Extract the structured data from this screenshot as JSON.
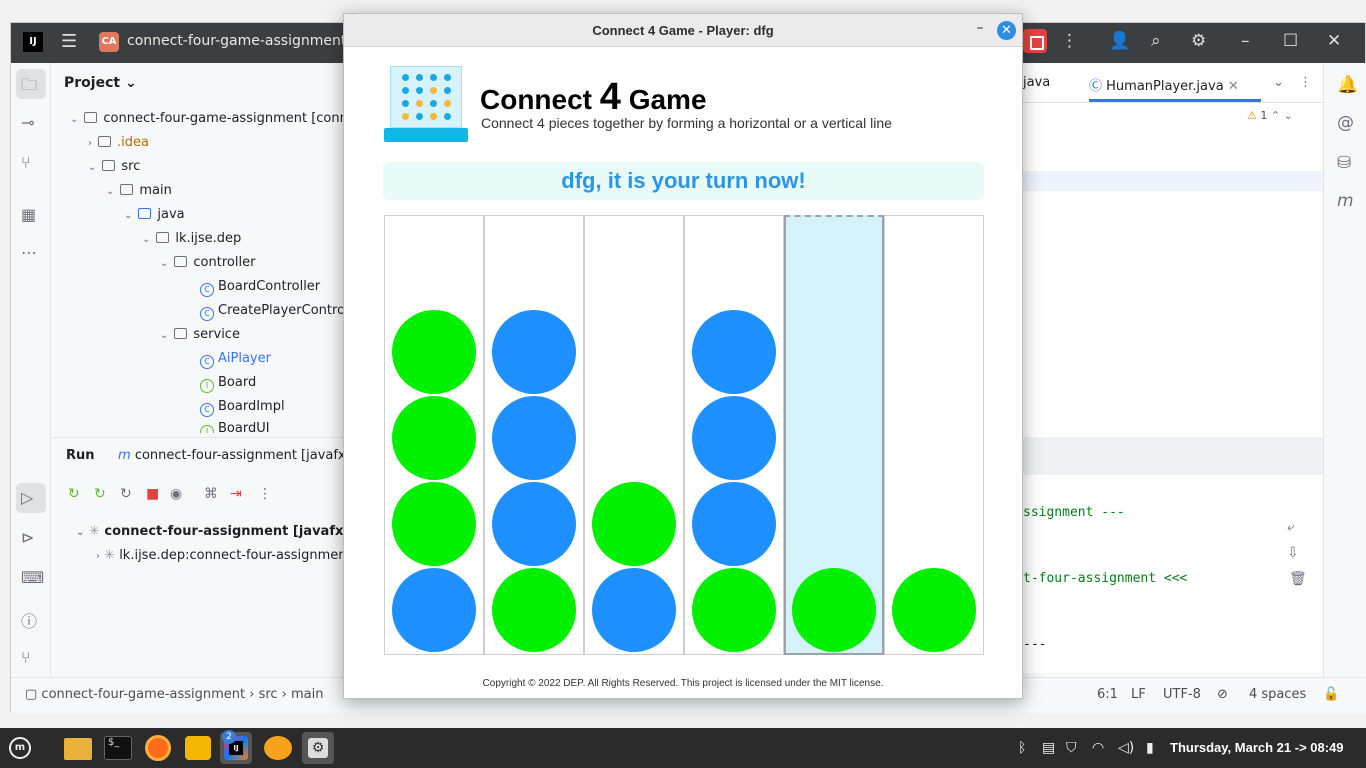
{
  "ide": {
    "project_badge": "CA",
    "project_name": "connect-four-game-assignment",
    "project_panel_title": "Project",
    "tree": [
      {
        "label": "connect-four-game-assignment [conn",
        "kind": "module"
      },
      {
        "label": ".idea",
        "kind": "folder"
      },
      {
        "label": "src",
        "kind": "folder"
      },
      {
        "label": "main",
        "kind": "folder"
      },
      {
        "label": "java",
        "kind": "folder"
      },
      {
        "label": "lk.ijse.dep",
        "kind": "package"
      },
      {
        "label": "controller",
        "kind": "package"
      },
      {
        "label": "BoardController",
        "kind": "class"
      },
      {
        "label": "CreatePlayerControll",
        "kind": "class"
      },
      {
        "label": "service",
        "kind": "package"
      },
      {
        "label": "AiPlayer",
        "kind": "class"
      },
      {
        "label": "Board",
        "kind": "interface"
      },
      {
        "label": "BoardImpl",
        "kind": "class"
      },
      {
        "label": "BoardUI",
        "kind": "interface"
      }
    ],
    "run_title": "Run",
    "run_tab": "connect-four-assignment [javafx",
    "run_rows": [
      "connect-four-assignment [javafx:run]:",
      "lk.ijse.dep:connect-four-assignmen"
    ],
    "editor_tabs": [
      "java",
      "HumanPlayer.java"
    ],
    "warning_count": "1",
    "console_lines": [
      "ssignment ---",
      "t-four-assignment <<<",
      "---"
    ],
    "breadcrumb": [
      "connect-four-game-assignment",
      "src",
      "main"
    ],
    "status": {
      "position": "6:1",
      "line_sep": "LF",
      "encoding": "UTF-8",
      "indent": "4 spaces"
    }
  },
  "game": {
    "window_title": "Connect 4 Game - Player: dfg",
    "title_pre": "Connect ",
    "title_num": "4",
    "title_post": " Game",
    "subtitle": "Connect 4 pieces together by forming a horizontal or a vertical line",
    "turn_message": "dfg, it is your turn now!",
    "copyright": "Copyright © 2022 DEP. All Rights Reserved. This project is licensed under the MIT license.",
    "colors": {
      "blue_player": "#1e90ff",
      "green_player": "#00f000",
      "banner_text": "#2a96e8",
      "selected_column": "#d5f1fa"
    },
    "selected_column": 4,
    "columns": [
      [
        "blue",
        "green",
        "green",
        "green"
      ],
      [
        "green",
        "blue",
        "blue",
        "blue"
      ],
      [
        "blue",
        "green"
      ],
      [
        "green",
        "blue",
        "blue",
        "blue"
      ],
      [
        "green"
      ],
      [
        "green"
      ]
    ]
  },
  "taskbar": {
    "apps": [
      "mint-menu-icon",
      "files-icon",
      "terminal-icon",
      "firefox-icon",
      "sheets-icon",
      "intellij-icon",
      "scratch-icon",
      "settings-icon"
    ],
    "intellij_badge": "2",
    "clock": "Thursday, March 21 -> 08:49"
  }
}
